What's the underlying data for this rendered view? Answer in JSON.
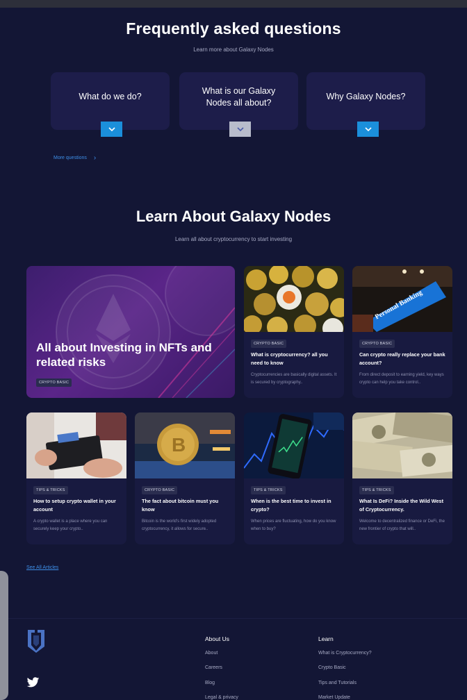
{
  "faq": {
    "title": "Frequently asked questions",
    "subtitle": "Learn more about Galaxy Nodes",
    "questions": [
      {
        "label": "What do we do?"
      },
      {
        "label": "What is our Galaxy Nodes all about?"
      },
      {
        "label": "Why Galaxy Nodes?"
      }
    ],
    "more_label": "More questions"
  },
  "learn": {
    "title": "Learn About Galaxy Nodes",
    "subtitle": "Learn all about cryptocurrency to start investing",
    "featured": {
      "title": "All about Investing in NFTs and related risks",
      "tag": "CRYPTO BASIC"
    },
    "articles": [
      {
        "tag": "CRYPTO BASIC",
        "title": "What is cryptocurrency? all you need to know",
        "desc": "Cryptocurrencies are basically digital assets. It is secured by cryptography.."
      },
      {
        "tag": "CRYPTO BASIC",
        "title": "Can crypto really replace your bank account?",
        "desc": "From direct deposit to earning yield, key ways crypto can help you take control.."
      },
      {
        "tag": "TIPS & TRICKS",
        "title": "How to setup crypto wallet in your account",
        "desc": "A crypto wallet is a place where you can securely keep your crypto.."
      },
      {
        "tag": "CRYPTO BASIC",
        "title": "The fact about bitcoin must you know",
        "desc": "Bitcoin is the world's first widely adopted cryptocurrency, it allows for secure.."
      },
      {
        "tag": "TIPS & TRICKS",
        "title": "When is the best time to invest in crypto?",
        "desc": "When prices are fluctuating, how do you know when to buy?"
      },
      {
        "tag": "TIPS & TRICKS",
        "title": "What Is DeFi? Inside the Wild West of Cryptocurrency.",
        "desc": "Welcome to decentralized finance or DeFi, the new frontier of crypto that will.."
      }
    ],
    "banner_text": "Personal Banking",
    "see_all": "See All Articles"
  },
  "footer": {
    "about": {
      "heading": "About Us",
      "items": [
        "About",
        "Careers",
        "Blog",
        "Legal & privacy"
      ]
    },
    "learn": {
      "heading": "Learn",
      "items": [
        "What is Cryptocurrency?",
        "Crypto Basic",
        "Tips and Tutorials",
        "Market Update"
      ]
    }
  },
  "colors": {
    "background": "#131635",
    "accent": "#1b8fdb",
    "link": "#3e8fe8"
  }
}
